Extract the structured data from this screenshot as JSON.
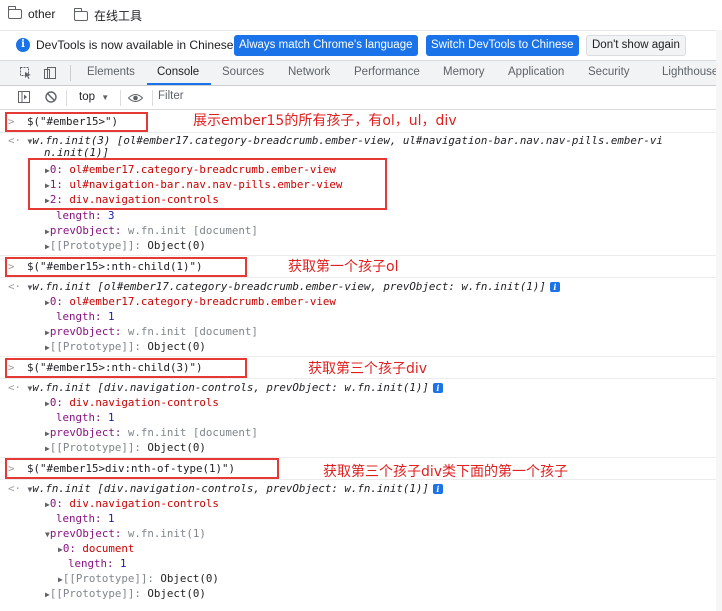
{
  "bookmarks": [
    {
      "label": "other"
    },
    {
      "label": "在线工具"
    }
  ],
  "infobar": {
    "message": "DevTools is now available in Chinese!",
    "btn_match": "Always match Chrome's language",
    "btn_switch": "Switch DevTools to Chinese",
    "btn_dont": "Don't show again"
  },
  "tabs": [
    "Elements",
    "Console",
    "Sources",
    "Network",
    "Performance",
    "Memory",
    "Application",
    "Security",
    "Lighthouse"
  ],
  "toolbar": {
    "context": "top",
    "filter_placeholder": "Filter"
  },
  "annotations": {
    "a1": "展示ember15的所有孩子，有ol，ul，div",
    "a2": "获取第一个孩子ol",
    "a3": "获取第三个孩子div",
    "a4": "获取第三个孩子div类下面的第一个孩子"
  },
  "entries": {
    "cmd1": "$(\"#ember15>\")",
    "cmd2": "$(\"#ember15>:nth-child(1)\")",
    "cmd3": "$(\"#ember15>:nth-child(3)\")",
    "cmd4": "$(\"#ember15>div:nth-of-type(1)\")",
    "r1_head": "w.fn.init(3) [ol#ember17.category-breadcrumb.ember-view, ul#navigation-bar.nav.nav-pills.ember-vi",
    "r1_head2": "n.init(1)]",
    "r1_0_k": "0:",
    "r1_0_v": "ol#ember17.category-breadcrumb.ember-view",
    "r1_1_k": "1:",
    "r1_1_v": "ul#navigation-bar.nav.nav-pills.ember-view",
    "r1_2_k": "2:",
    "r1_2_v": "div.navigation-controls",
    "r1_len_k": "length:",
    "r1_len_v": "3",
    "r1_prev_k": "prevObject:",
    "r1_prev_v": "w.fn.init [document]",
    "proto_k": "[[Prototype]]:",
    "proto_v": "Object(0)",
    "r2_head": "w.fn.init [ol#ember17.category-breadcrumb.ember-view, prevObject: w.fn.init(1)]",
    "r2_0_v": "ol#ember17.category-breadcrumb.ember-view",
    "r2_len_v": "1",
    "r2_prev_v": "w.fn.init [document]",
    "r3_head": "w.fn.init [div.navigation-controls, prevObject: w.fn.init(1)]",
    "r3_0_v": "div.navigation-controls",
    "r3_len_v": "1",
    "r3_prev_v": "w.fn.init [document]",
    "r4_head": "w.fn.init [div.navigation-controls, prevObject: w.fn.init(1)]",
    "r4_0_v": "div.navigation-controls",
    "r4_len_v": "1",
    "r4_prev_v": "w.fn.init(1)",
    "r4_sub0_k": "0:",
    "r4_sub0_v": "document",
    "r4_sublen_v": "1"
  }
}
